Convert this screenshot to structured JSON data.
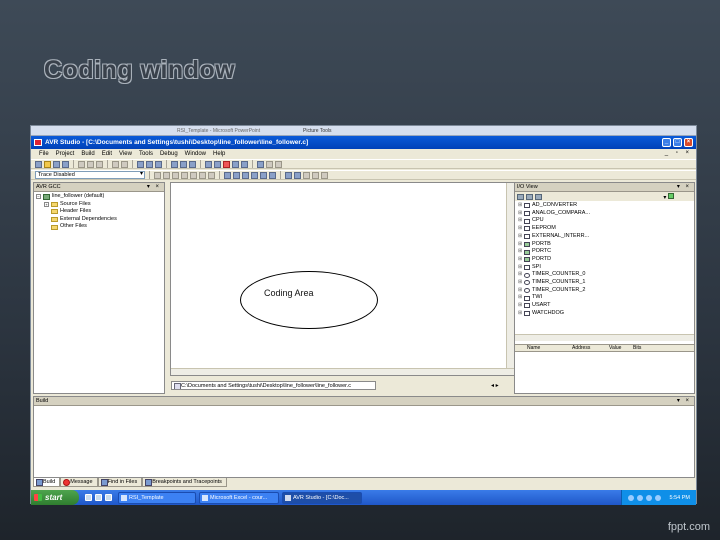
{
  "slide": {
    "title": "Coding window",
    "footer": "fppt.com"
  },
  "powerpoint_bar": {
    "doc_title": "RSI_Template - Microsoft PowerPoint",
    "context_tab": "Picture Tools"
  },
  "window": {
    "title": "AVR Studio - [C:\\Documents and Settings\\tushi\\Desktop\\line_follower\\line_follower.c]",
    "controls": [
      "_",
      "□",
      "×"
    ]
  },
  "menu": [
    "File",
    "Project",
    "Build",
    "Edit",
    "View",
    "Tools",
    "Debug",
    "Window",
    "Help"
  ],
  "toolbar": {
    "trace_select": "Trace Disabled"
  },
  "project_pane": {
    "header": "AVR GCC",
    "root": "line_follower (default)",
    "items": [
      "Source Files",
      "Header Files",
      "External Dependencies",
      "Other Files"
    ]
  },
  "editor": {
    "annotation": "Coding Area",
    "file_tab": "C:\\Documents and Settings\\tushi\\Desktop\\line_follower\\line_follower.c"
  },
  "io_view": {
    "header": "I/O View",
    "items": [
      "AD_CONVERTER",
      "ANALOG_COMPARA...",
      "CPU",
      "EEPROM",
      "EXTERNAL_INTERR...",
      "PORTB",
      "PORTC",
      "PORTD",
      "SPI",
      "TIMER_COUNTER_0",
      "TIMER_COUNTER_1",
      "TIMER_COUNTER_2",
      "TWI",
      "USART",
      "WATCHDOG"
    ],
    "columns": [
      "Name",
      "Address",
      "Value",
      "Bits"
    ]
  },
  "build_pane": {
    "header": "Build",
    "tabs": [
      "Build",
      "Message",
      "Find in Files",
      "Breakpoints and Tracepoints"
    ]
  },
  "taskbar": {
    "start": "start",
    "tasks": [
      "RSI_Template",
      "Microsoft Excel - cour...",
      "AVR Studio - [C:\\Doc..."
    ],
    "clock": "5:54 PM"
  }
}
